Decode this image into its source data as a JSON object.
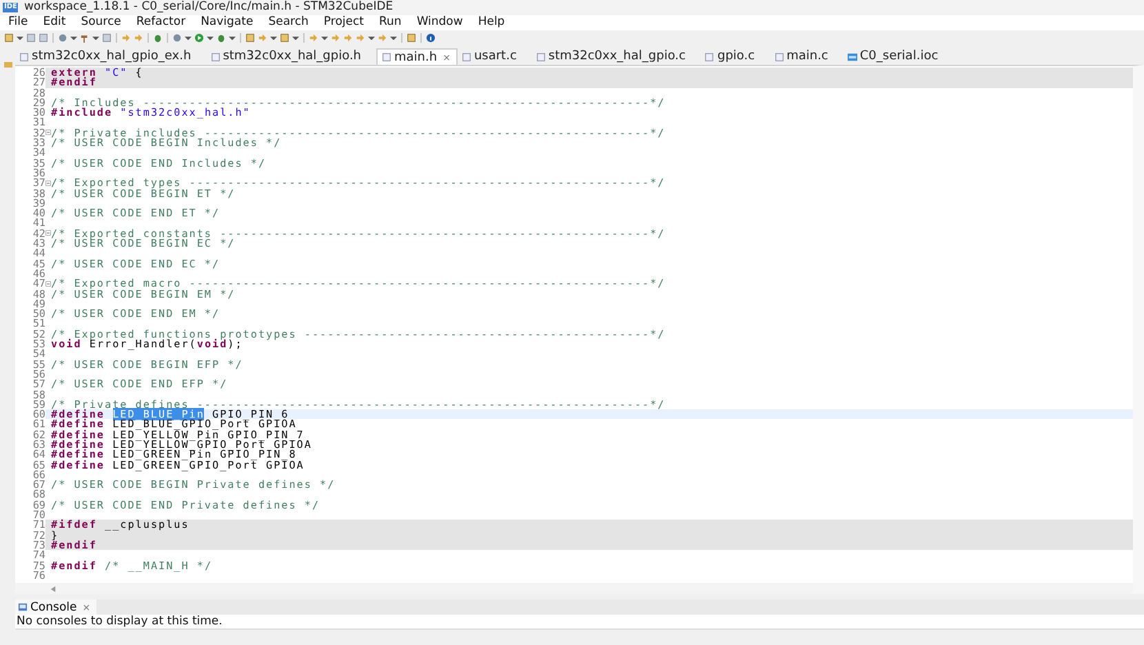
{
  "window": {
    "icon_label": "IDE",
    "title": "workspace_1.18.1 - C0_serial/Core/Inc/main.h - STM32CubeIDE"
  },
  "menu_bar": [
    "File",
    "Edit",
    "Source",
    "Refactor",
    "Navigate",
    "Search",
    "Project",
    "Run",
    "Window",
    "Help"
  ],
  "tabs": [
    {
      "label": "stm32c0xx_hal_gpio_ex.h",
      "kind": "file",
      "selected": false
    },
    {
      "label": "stm32c0xx_hal_gpio.h",
      "kind": "file",
      "selected": false
    },
    {
      "label": "main.h",
      "kind": "file",
      "selected": true,
      "close_glyph": "×"
    },
    {
      "label": "usart.c",
      "kind": "file",
      "selected": false
    },
    {
      "label": "stm32c0xx_hal_gpio.c",
      "kind": "file",
      "selected": false
    },
    {
      "label": "gpio.c",
      "kind": "file",
      "selected": false
    },
    {
      "label": "main.c",
      "kind": "file",
      "selected": false
    },
    {
      "label": "C0_serial.ioc",
      "kind": "config",
      "selected": false
    }
  ],
  "editor": {
    "lines": [
      {
        "number": "26",
        "kind": "inactive",
        "folding": false,
        "segments": [
          {
            "kind": "keyword",
            "text": "extern "
          },
          {
            "kind": "string",
            "text": "\"C\""
          },
          {
            "kind": "plain",
            "text": " {"
          }
        ]
      },
      {
        "number": "27",
        "kind": "inactive",
        "folding": false,
        "segments": [
          {
            "kind": "directive",
            "text": "#endif"
          }
        ]
      },
      {
        "number": "28",
        "kind": "normal",
        "folding": false
      },
      {
        "number": "29",
        "kind": "normal",
        "folding": false,
        "segments": [
          {
            "kind": "comment",
            "text": "/* Includes ------------------------------------------------------------------*/"
          }
        ]
      },
      {
        "number": "30",
        "kind": "normal",
        "folding": false,
        "segments": [
          {
            "kind": "directive",
            "text": "#include "
          },
          {
            "kind": "string",
            "text": "\"stm32c0xx_hal.h\""
          }
        ]
      },
      {
        "number": "31",
        "kind": "normal",
        "folding": false
      },
      {
        "number": "32",
        "kind": "normal",
        "folding": true,
        "segments": [
          {
            "kind": "comment",
            "text": "/* Private includes ----------------------------------------------------------*/"
          }
        ]
      },
      {
        "number": "33",
        "kind": "normal",
        "folding": false,
        "segments": [
          {
            "kind": "comment",
            "text": "/* USER CODE BEGIN Includes */"
          }
        ]
      },
      {
        "number": "34",
        "kind": "normal",
        "folding": false
      },
      {
        "number": "35",
        "kind": "normal",
        "folding": false,
        "segments": [
          {
            "kind": "comment",
            "text": "/* USER CODE END Includes */"
          }
        ]
      },
      {
        "number": "36",
        "kind": "normal",
        "folding": false
      },
      {
        "number": "37",
        "kind": "normal",
        "folding": true,
        "segments": [
          {
            "kind": "comment",
            "text": "/* Exported types ------------------------------------------------------------*/"
          }
        ]
      },
      {
        "number": "38",
        "kind": "normal",
        "folding": false,
        "segments": [
          {
            "kind": "comment",
            "text": "/* USER CODE BEGIN ET */"
          }
        ]
      },
      {
        "number": "39",
        "kind": "normal",
        "folding": false
      },
      {
        "number": "40",
        "kind": "normal",
        "folding": false,
        "segments": [
          {
            "kind": "comment",
            "text": "/* USER CODE END ET */"
          }
        ]
      },
      {
        "number": "41",
        "kind": "normal",
        "folding": false
      },
      {
        "number": "42",
        "kind": "normal",
        "folding": true,
        "segments": [
          {
            "kind": "comment",
            "text": "/* Exported constants --------------------------------------------------------*/"
          }
        ]
      },
      {
        "number": "43",
        "kind": "normal",
        "folding": false,
        "segments": [
          {
            "kind": "comment",
            "text": "/* USER CODE BEGIN EC */"
          }
        ]
      },
      {
        "number": "44",
        "kind": "normal",
        "folding": false
      },
      {
        "number": "45",
        "kind": "normal",
        "folding": false,
        "segments": [
          {
            "kind": "comment",
            "text": "/* USER CODE END EC */"
          }
        ]
      },
      {
        "number": "46",
        "kind": "normal",
        "folding": false
      },
      {
        "number": "47",
        "kind": "normal",
        "folding": true,
        "segments": [
          {
            "kind": "comment",
            "text": "/* Exported macro ------------------------------------------------------------*/"
          }
        ]
      },
      {
        "number": "48",
        "kind": "normal",
        "folding": false,
        "segments": [
          {
            "kind": "comment",
            "text": "/* USER CODE BEGIN EM */"
          }
        ]
      },
      {
        "number": "49",
        "kind": "normal",
        "folding": false
      },
      {
        "number": "50",
        "kind": "normal",
        "folding": false,
        "segments": [
          {
            "kind": "comment",
            "text": "/* USER CODE END EM */"
          }
        ]
      },
      {
        "number": "51",
        "kind": "normal",
        "folding": false
      },
      {
        "number": "52",
        "kind": "normal",
        "folding": false,
        "segments": [
          {
            "kind": "comment",
            "text": "/* Exported functions prototypes ---------------------------------------------*/"
          }
        ]
      },
      {
        "number": "53",
        "kind": "normal",
        "folding": false,
        "segments": [
          {
            "kind": "keyword",
            "text": "void"
          },
          {
            "kind": "plain",
            "text": " Error_Handler("
          },
          {
            "kind": "keyword",
            "text": "void"
          },
          {
            "kind": "plain",
            "text": ");"
          }
        ]
      },
      {
        "number": "54",
        "kind": "normal",
        "folding": false
      },
      {
        "number": "55",
        "kind": "normal",
        "folding": false,
        "segments": [
          {
            "kind": "comment",
            "text": "/* USER CODE BEGIN EFP */"
          }
        ]
      },
      {
        "number": "56",
        "kind": "normal",
        "folding": false
      },
      {
        "number": "57",
        "kind": "normal",
        "folding": false,
        "segments": [
          {
            "kind": "comment",
            "text": "/* USER CODE END EFP */"
          }
        ]
      },
      {
        "number": "58",
        "kind": "normal",
        "folding": false
      },
      {
        "number": "59",
        "kind": "normal",
        "folding": false,
        "segments": [
          {
            "kind": "comment",
            "text": "/* Private defines -----------------------------------------------------------*/"
          }
        ]
      },
      {
        "number": "60",
        "kind": "current",
        "folding": false,
        "segments": [
          {
            "kind": "directive",
            "text": "#define "
          },
          {
            "kind": "selection",
            "text": "LED_BLUE_Pin"
          },
          {
            "kind": "plain",
            "text": " GPIO_PIN_6"
          }
        ]
      },
      {
        "number": "61",
        "kind": "normal",
        "folding": false,
        "segments": [
          {
            "kind": "directive",
            "text": "#define"
          },
          {
            "kind": "plain",
            "text": " LED_BLUE_GPIO_Port GPIOA"
          }
        ]
      },
      {
        "number": "62",
        "kind": "normal",
        "folding": false,
        "segments": [
          {
            "kind": "directive",
            "text": "#define"
          },
          {
            "kind": "plain",
            "text": " LED_YELLOW_Pin GPIO_PIN_7"
          }
        ]
      },
      {
        "number": "63",
        "kind": "normal",
        "folding": false,
        "segments": [
          {
            "kind": "directive",
            "text": "#define"
          },
          {
            "kind": "plain",
            "text": " LED_YELLOW_GPIO_Port GPIOA"
          }
        ]
      },
      {
        "number": "64",
        "kind": "normal",
        "folding": false,
        "segments": [
          {
            "kind": "directive",
            "text": "#define"
          },
          {
            "kind": "plain",
            "text": " LED_GREEN_Pin GPIO_PIN_8"
          }
        ]
      },
      {
        "number": "65",
        "kind": "normal",
        "folding": false,
        "segments": [
          {
            "kind": "directive",
            "text": "#define"
          },
          {
            "kind": "plain",
            "text": " LED_GREEN_GPIO_Port GPIOA"
          }
        ]
      },
      {
        "number": "66",
        "kind": "normal",
        "folding": false
      },
      {
        "number": "67",
        "kind": "normal",
        "folding": false,
        "segments": [
          {
            "kind": "comment",
            "text": "/* USER CODE BEGIN Private defines */"
          }
        ]
      },
      {
        "number": "68",
        "kind": "normal",
        "folding": false
      },
      {
        "number": "69",
        "kind": "normal",
        "folding": false,
        "segments": [
          {
            "kind": "comment",
            "text": "/* USER CODE END Private defines */"
          }
        ]
      },
      {
        "number": "70",
        "kind": "normal",
        "folding": false
      },
      {
        "number": "71",
        "kind": "inactive",
        "folding": false,
        "segments": [
          {
            "kind": "directive",
            "text": "#ifdef"
          },
          {
            "kind": "plain",
            "text": " __cplusplus"
          }
        ]
      },
      {
        "number": "72",
        "kind": "inactive",
        "folding": false,
        "segments": [
          {
            "kind": "plain",
            "text": "}"
          }
        ]
      },
      {
        "number": "73",
        "kind": "inactive",
        "folding": false,
        "segments": [
          {
            "kind": "directive",
            "text": "#endif"
          }
        ]
      },
      {
        "number": "74",
        "kind": "normal",
        "folding": false
      },
      {
        "number": "75",
        "kind": "normal",
        "folding": false,
        "segments": [
          {
            "kind": "directive",
            "text": "#endif "
          },
          {
            "kind": "comment",
            "text": "/* __MAIN_H */"
          }
        ]
      },
      {
        "number": "76",
        "kind": "normal",
        "folding": false
      }
    ]
  },
  "console": {
    "tab_label": "Console",
    "close_glyph": "×",
    "message": "No consoles to display at this time."
  }
}
